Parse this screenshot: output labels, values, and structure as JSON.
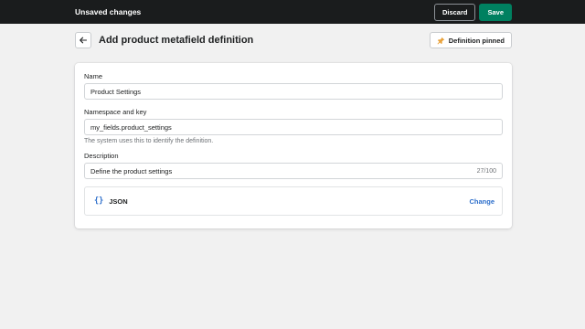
{
  "topbar": {
    "title": "Unsaved changes",
    "discard_label": "Discard",
    "save_label": "Save"
  },
  "header": {
    "back_icon": "arrow-left-icon",
    "title": "Add product metafield definition",
    "pin_icon": "pin-icon",
    "pin_label": "Definition pinned"
  },
  "form": {
    "name": {
      "label": "Name",
      "value": "Product Settings"
    },
    "namespace": {
      "label": "Namespace and key",
      "value": "my_fields.product_settings",
      "help": "The system uses this to identify the definition."
    },
    "description": {
      "label": "Description",
      "value": "Define the product settings",
      "counter": "27/100"
    },
    "type": {
      "icon_glyph": "{}",
      "label": "JSON",
      "change_label": "Change"
    }
  },
  "colors": {
    "topbar_bg": "#1a1c1d",
    "save_green": "#008060",
    "link_blue": "#2c6ecb",
    "page_bg": "#f1f1f1"
  }
}
